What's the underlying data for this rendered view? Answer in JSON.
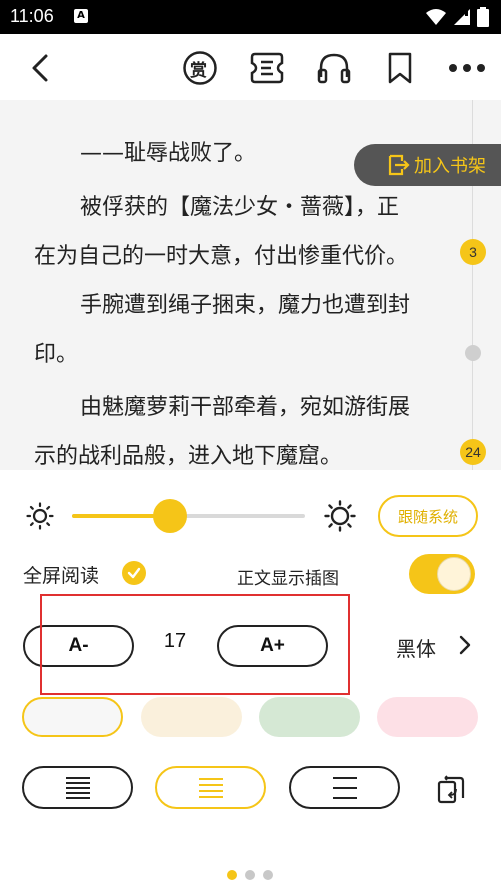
{
  "status_bar": {
    "time": "11:06",
    "notif_letter": "A"
  },
  "nav": {
    "icons": [
      "back-icon",
      "reward-icon",
      "chapter-list-icon",
      "audio-icon",
      "bookmark-icon",
      "more-icon"
    ],
    "reward_glyph": "赏"
  },
  "reader": {
    "paragraphs": [
      [
        "——耻辱战败了。"
      ],
      [
        "被俘获的【魔法少女・蔷薇】，正",
        "在为自己的一时大意，付出惨重代价。"
      ],
      [
        "手腕遭到绳子捆束，魔力也遭到封",
        "印。"
      ],
      [
        "由魅魔萝莉干部牵着，宛如游街展",
        "示的战利品般，进入地下魔窟。"
      ]
    ],
    "comment_counts": [
      "3",
      "24"
    ],
    "add_shelf_label": "加入书架"
  },
  "settings": {
    "brightness": 0.42,
    "follow_system_label": "跟随系统",
    "fullscreen_label": "全屏阅读",
    "fullscreen_checked": true,
    "show_images_label": "正文显示插图",
    "show_images_on": true,
    "font_decrease_label": "A-",
    "font_size": "17",
    "font_increase_label": "A+",
    "font_name": "黑体",
    "themes": [
      {
        "name": "white",
        "color": "#f7f7f7",
        "selected": true
      },
      {
        "name": "cream",
        "color": "#faf0dc",
        "selected": false
      },
      {
        "name": "green",
        "color": "#d5e8d4",
        "selected": false
      },
      {
        "name": "pink",
        "color": "#fde0e6",
        "selected": false
      }
    ],
    "accent_color": "#f5c518",
    "page_index": 0,
    "page_count": 3
  }
}
